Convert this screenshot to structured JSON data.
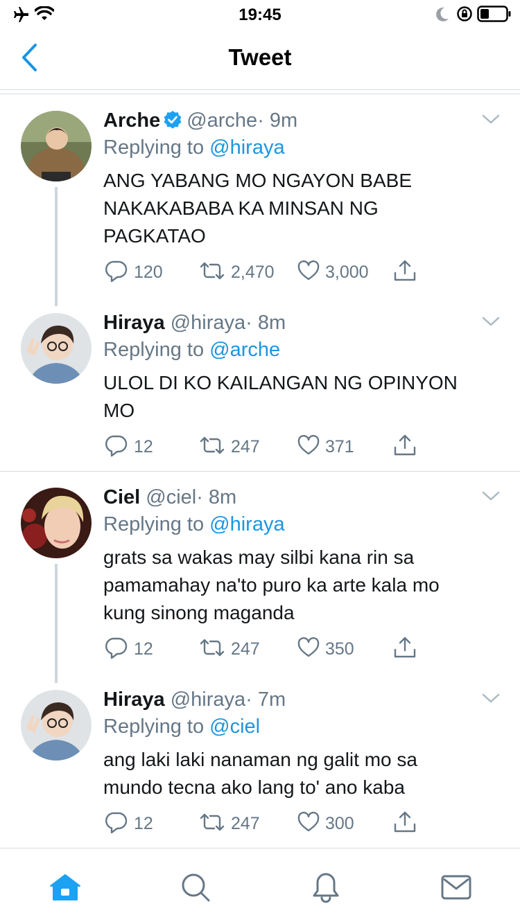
{
  "status_bar": {
    "time": "19:45",
    "left_icons": [
      "airplane-icon",
      "wifi-icon"
    ],
    "right_icons": [
      "moon-icon",
      "rotation-lock-icon",
      "battery-icon"
    ]
  },
  "nav": {
    "title": "Tweet",
    "back_icon": "chevron-left-icon"
  },
  "colors": {
    "accent": "#1b95e0",
    "secondary_text": "#657786",
    "primary_text": "#14171a",
    "divider": "#d7dbe0",
    "thread_line": "#ccd6dd",
    "verified": "#1da1f2"
  },
  "tweets": [
    {
      "name": "Arche",
      "verified": true,
      "handle": "@arche",
      "time": "· 9m",
      "replying_prefix": "Replying to",
      "replying_to": "@hiraya",
      "text_lines": [
        "ANG YABANG MO NGAYON BABE",
        "NAKAKABABA KA MINSAN NG",
        "PAGKATAO"
      ],
      "replies": "120",
      "retweets": "2,470",
      "likes": "3,000"
    },
    {
      "name": "Hiraya",
      "verified": false,
      "handle": "@hiraya",
      "time": "· 8m",
      "replying_prefix": "Replying to",
      "replying_to": "@arche",
      "text_lines": [
        "ULOL DI KO KAILANGAN NG OPINYON",
        "MO"
      ],
      "replies": "12",
      "retweets": "247",
      "likes": "371"
    },
    {
      "name": "Ciel",
      "verified": false,
      "handle": "@ciel",
      "time": "· 8m",
      "replying_prefix": "Replying to",
      "replying_to": "@hiraya",
      "text_lines": [
        "grats sa wakas may silbi kana rin sa",
        "pamamahay na'to puro ka arte kala mo",
        "kung sinong maganda"
      ],
      "replies": "12",
      "retweets": "247",
      "likes": "350"
    },
    {
      "name": "Hiraya",
      "verified": false,
      "handle": "@hiraya",
      "time": "· 7m",
      "replying_prefix": "Replying to",
      "replying_to": "@ciel",
      "text_lines": [
        "ang laki laki nanaman ng galit mo sa",
        "mundo tecna ako lang to' ano kaba"
      ],
      "replies": "12",
      "retweets": "247",
      "likes": "300"
    }
  ],
  "tab_bar": {
    "tabs": [
      "home-icon",
      "search-icon",
      "notifications-icon",
      "messages-icon"
    ],
    "active": "home-icon"
  }
}
